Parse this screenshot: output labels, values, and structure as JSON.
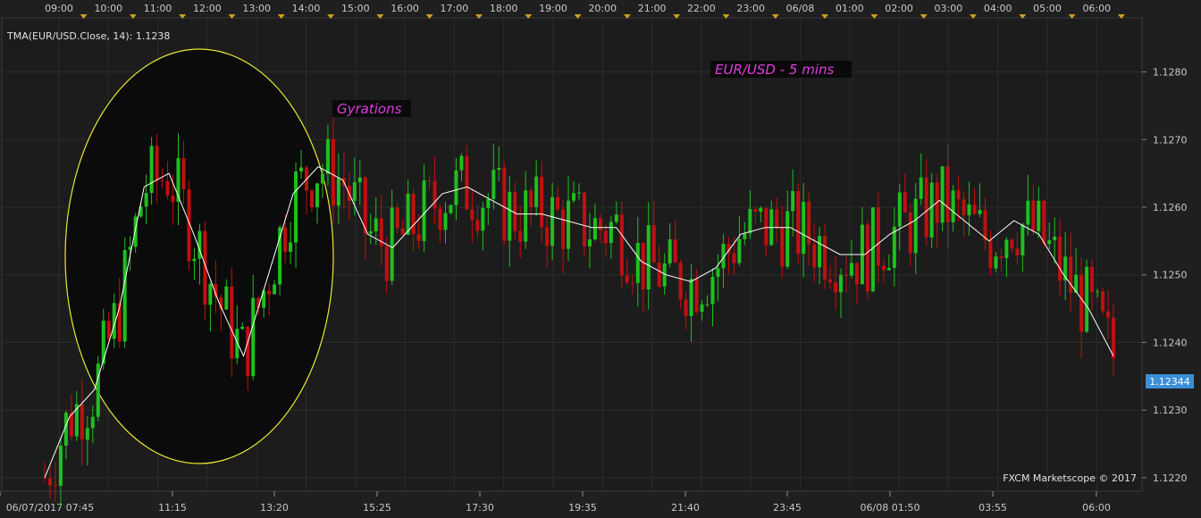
{
  "indicator_label": "TMA(EUR/USD.Close, 14): 1.1238",
  "watermark": "FXCM Marketscope © 2017",
  "annotations": {
    "title": "EUR/USD - 5 mins",
    "note": "Gyrations"
  },
  "current_price": "1.12344",
  "colors": {
    "background": "#1f1f1f",
    "grid": "#2c2c2c",
    "up": "#1fbf1f",
    "down": "#c01010",
    "tma": "#ffffff",
    "ellipse": "#e8e830",
    "annotation": "#e03ce0",
    "price_tag": "#3a8fd8"
  },
  "top_axis": [
    "09:00",
    "10:00",
    "11:00",
    "12:00",
    "13:00",
    "14:00",
    "15:00",
    "16:00",
    "17:00",
    "18:00",
    "19:00",
    "20:00",
    "21:00",
    "22:00",
    "23:00",
    "06/08",
    "01:00",
    "02:00",
    "03:00",
    "04:00",
    "05:00",
    "06:00"
  ],
  "bottom_axis": [
    "06/07/2017 07:45",
    "11:15",
    "13:20",
    "15:25",
    "17:30",
    "19:35",
    "21:40",
    "23:45",
    "06/08 01:50",
    "03:55",
    "06:00"
  ],
  "chart_data": {
    "type": "line",
    "ylim": [
      1.1218,
      1.1288
    ],
    "y_ticks": [
      "1.1220",
      "1.1230",
      "1.1240",
      "1.1250",
      "1.1260",
      "1.1270",
      "1.1280"
    ],
    "grid": true,
    "series": [
      {
        "x": [
          "06/07 07:45",
          "08:30",
          "09:15",
          "10:00",
          "10:30",
          "11:00",
          "11:30",
          "12:00",
          "12:30",
          "13:00",
          "13:30",
          "14:00",
          "14:30",
          "15:00",
          "15:30",
          "16:00",
          "16:30",
          "17:00",
          "17:30",
          "18:00",
          "18:30",
          "19:00",
          "19:30",
          "20:00",
          "20:30",
          "21:00",
          "21:30",
          "22:00",
          "22:30",
          "23:00",
          "23:30",
          "06/08 00:00",
          "00:30",
          "01:00",
          "01:30",
          "02:00",
          "02:30",
          "03:00",
          "03:30",
          "04:00",
          "04:30",
          "05:00",
          "05:30",
          "06:00"
        ],
        "values": [
          1.122,
          1.1229,
          1.1233,
          1.1245,
          1.1263,
          1.1265,
          1.1256,
          1.1246,
          1.1238,
          1.125,
          1.1262,
          1.1266,
          1.1264,
          1.1256,
          1.1254,
          1.1258,
          1.1262,
          1.1263,
          1.1261,
          1.1259,
          1.1259,
          1.1258,
          1.1257,
          1.1257,
          1.1252,
          1.125,
          1.1249,
          1.1251,
          1.1256,
          1.1257,
          1.1257,
          1.1255,
          1.1253,
          1.1253,
          1.1256,
          1.1258,
          1.1261,
          1.1258,
          1.1255,
          1.1258,
          1.1256,
          1.125,
          1.1245,
          1.1238
        ]
      }
    ]
  }
}
